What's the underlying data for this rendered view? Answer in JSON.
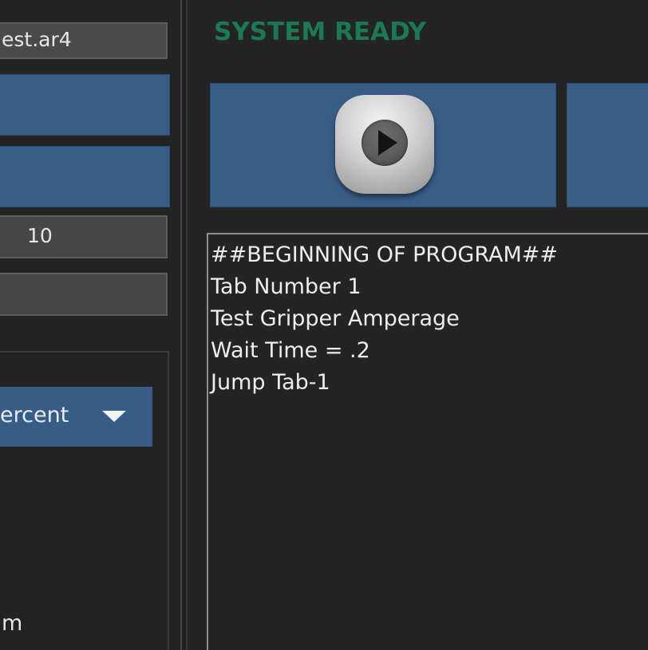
{
  "left_panel": {
    "program_file": "est.ar4",
    "speed_value": "10",
    "empty_field_value": "",
    "speed_type_dropdown": {
      "selected": "ercent",
      "icon": "triangle-down-icon"
    },
    "bottom_label": "m"
  },
  "right_panel": {
    "status_text": "SYSTEM READY",
    "run_button_icon": "play-icon",
    "program_lines": [
      "##BEGINNING OF PROGRAM##",
      "Tab Number 1",
      "Test Gripper Amperage",
      "Wait Time = .2",
      "Jump Tab-1"
    ]
  },
  "colors": {
    "background": "#242424",
    "button_blue": "#385d87",
    "field_gray": "#4a4a4a",
    "status_green": "#1a7a52",
    "text_light": "#ededed"
  }
}
